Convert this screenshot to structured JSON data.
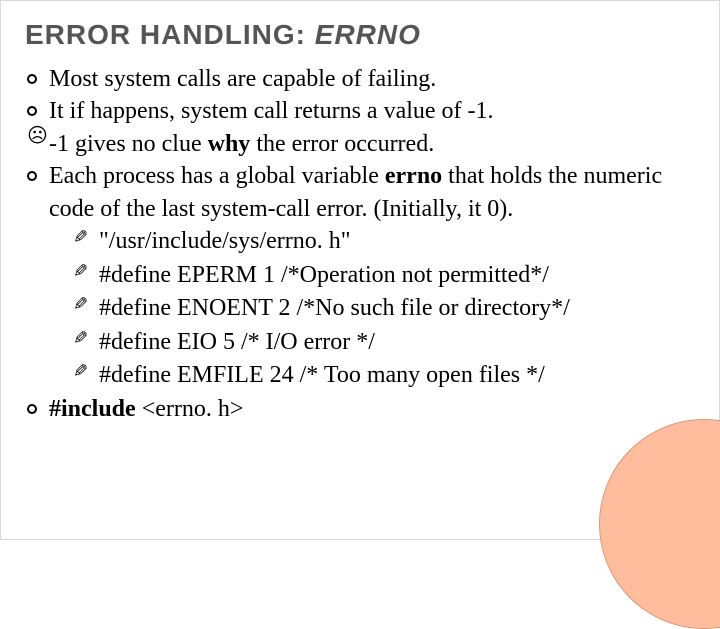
{
  "title_a": "ERROR HANDLING: ",
  "title_b": "ERRNO",
  "b1_a": "Most system calls are capable of failing.",
  "b2_a": "It if happens, system call returns a value of -1.",
  "b3_a": "-1 gives no clue ",
  "b3_b": "why",
  "b3_c": " the error occurred.",
  "b4_a": "Each process has a global variable ",
  "b4_b": "errno",
  "b4_c": " that holds the numeric code of the last system-call error. (Initially, it 0).",
  "s1": "\"/usr/include/sys/errno. h\"",
  "s2": "#define EPERM 1 /*Operation not permitted*/",
  "s3": "#define ENOENT 2 /*No such file or directory*/",
  "s4": "#define EIO 5 /* I/O error */",
  "s5": "#define EMFILE 24 /* Too many open files */",
  "b5_a": "#include",
  "b5_b": " <errno. h>"
}
